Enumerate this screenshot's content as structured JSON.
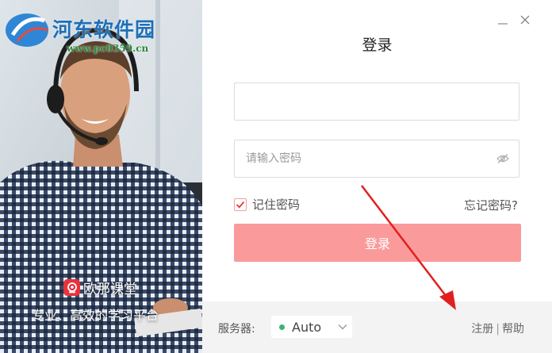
{
  "watermark": {
    "title": "河东软件园",
    "url": "www.pc0359.cn"
  },
  "brand": {
    "name": "欧那课堂",
    "slogan": "专业、高效的学习平台",
    "logo_icon": "webcam-icon"
  },
  "window": {
    "minimize_icon": "minimize-icon",
    "close_icon": "close-icon"
  },
  "login": {
    "title": "登录",
    "username": {
      "value": "",
      "placeholder": ""
    },
    "password": {
      "value": "",
      "placeholder": "请输入密码",
      "toggle_icon": "eye-off-icon"
    },
    "remember_label": "记住密码",
    "remember_checked": true,
    "forgot_label": "忘记密码?",
    "submit_label": "登录"
  },
  "footer": {
    "server_label": "服务器:",
    "server_value": "Auto",
    "server_status": "online",
    "register_label": "注册",
    "separator": "|",
    "help_label": "帮助"
  },
  "colors": {
    "accent": "#fb9a9a",
    "brand_red": "#e8323c",
    "status_green": "#3cb371",
    "annotation_arrow": "#e02020"
  }
}
